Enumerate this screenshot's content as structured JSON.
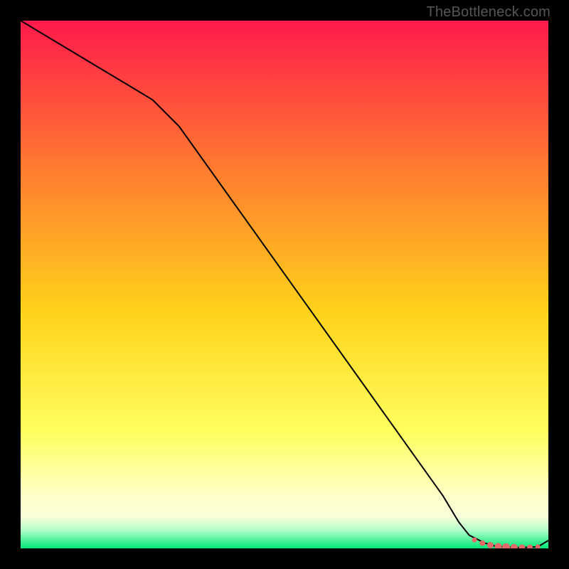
{
  "watermark": "TheBottleneck.com",
  "colors": {
    "grad_top": "#ff1a4b",
    "grad_q1": "#ff7b30",
    "grad_mid": "#ffd21a",
    "grad_q3": "#ffff60",
    "grad_q35": "#ffffc8",
    "grad_yellow_end": "#f8ffd8",
    "grad_green_top": "#b4ffcc",
    "grad_bottom": "#00e676",
    "line": "#000000",
    "marker": "#e46a6a"
  },
  "chart_data": {
    "type": "line",
    "title": "",
    "xlabel": "",
    "ylabel": "",
    "xlim": [
      0,
      100
    ],
    "ylim": [
      0,
      100
    ],
    "series": [
      {
        "name": "bottleneck-curve",
        "x": [
          0,
          5,
          10,
          15,
          20,
          25,
          30,
          35,
          40,
          45,
          50,
          55,
          60,
          65,
          70,
          75,
          80,
          83,
          85,
          88,
          90,
          93,
          95,
          98,
          100
        ],
        "y": [
          100,
          97,
          94,
          91,
          88,
          85,
          80,
          73,
          66,
          59,
          52,
          45,
          38,
          31,
          24,
          17,
          10,
          5,
          2.5,
          1.0,
          0.4,
          0.2,
          0.15,
          0.3,
          1.5
        ]
      }
    ],
    "markers": {
      "name": "highlight-points",
      "x": [
        86,
        87.5,
        89,
        90.5,
        92,
        93.5,
        95,
        96.5,
        98
      ],
      "y": [
        1.6,
        1.0,
        0.6,
        0.35,
        0.22,
        0.17,
        0.15,
        0.18,
        0.3
      ]
    }
  }
}
